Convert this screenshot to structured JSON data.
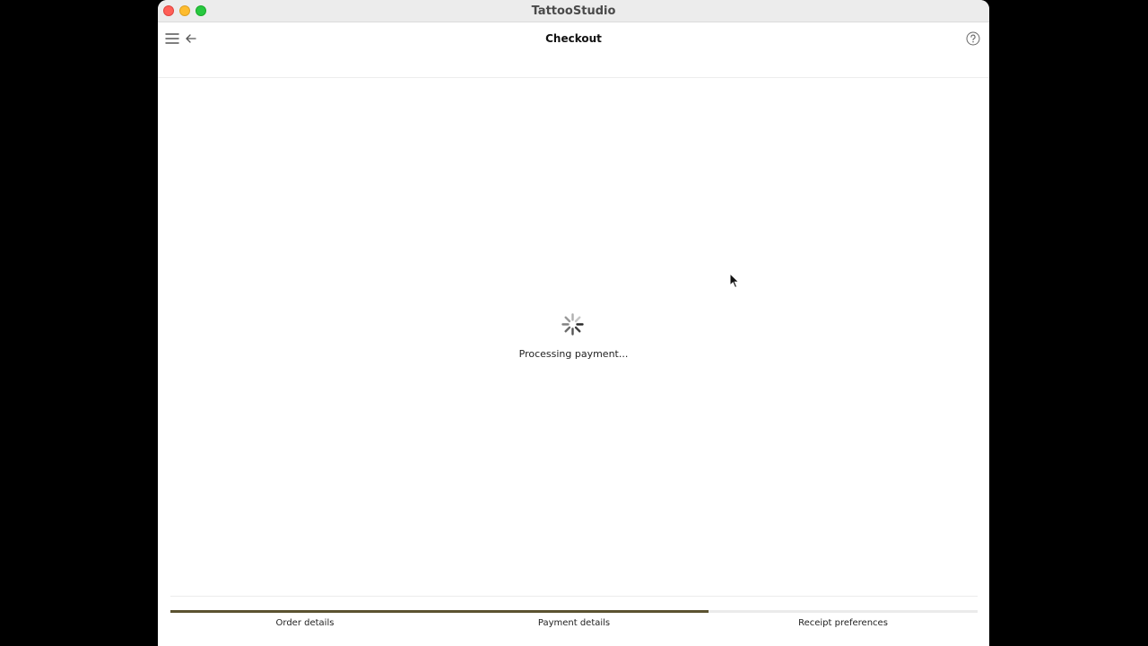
{
  "window": {
    "title": "TattooStudio"
  },
  "toolbar": {
    "title": "Checkout",
    "menu_icon": "hamburger-menu-icon",
    "back_icon": "arrow-left-icon",
    "help_icon": "question-circle-icon"
  },
  "main": {
    "status": "Processing payment...",
    "spinner_icon": "loading-spinner-icon"
  },
  "checkout_steps": {
    "progress": 0.667,
    "items": [
      {
        "label": "Order details"
      },
      {
        "label": "Payment details"
      },
      {
        "label": "Receipt preferences"
      }
    ]
  },
  "colors": {
    "accent": "#5b5230",
    "track": "#ebebeb",
    "close": "#ff5f57",
    "minimize": "#febc2e",
    "maximize": "#28c840"
  }
}
